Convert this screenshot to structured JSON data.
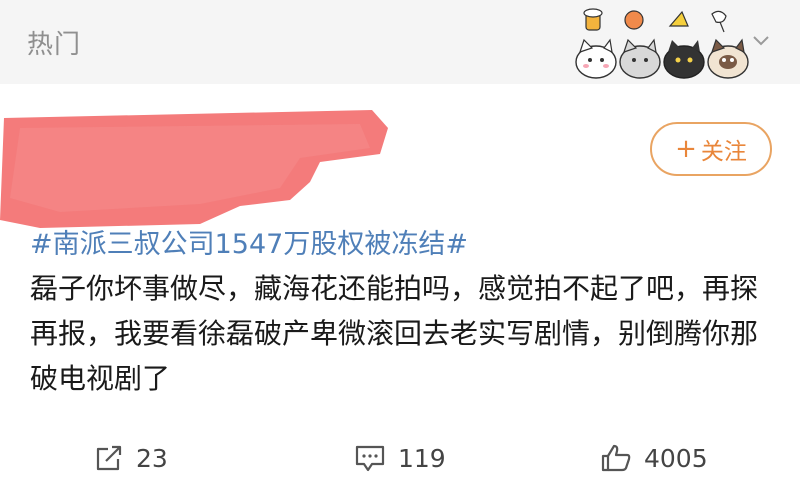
{
  "header": {
    "section_title": "热门"
  },
  "post": {
    "follow_label": "关注",
    "hashtag": "#南派三叔公司1547万股权被冻结#",
    "body": "磊子你坏事做尽，藏海花还能拍吗，感觉拍不起了吧，再探再报，我要看徐磊破产卑微滚回去老实写剧情，别倒腾你那破电视剧了"
  },
  "actions": {
    "share_count": "23",
    "comment_count": "119",
    "like_count": "4005"
  },
  "colors": {
    "accent_orange": "#e9863a",
    "hashtag_blue": "#4f7fb8",
    "redaction": "#f47b7b"
  }
}
